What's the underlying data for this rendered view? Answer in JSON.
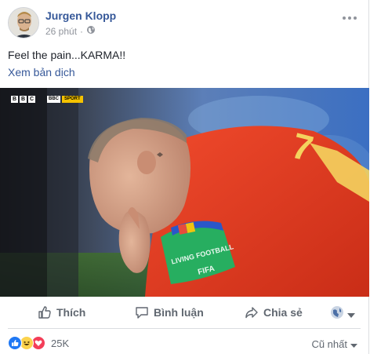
{
  "post": {
    "author": "Jurgen Klopp",
    "time": "26 phút",
    "dot": "·",
    "text": "Feel the pain...KARMA!!",
    "translate_link": "Xem bản dịch",
    "more_icon": "more-horizontal-icon",
    "privacy_icon": "globe-icon"
  },
  "photo": {
    "broadcaster": [
      "B",
      "B",
      "C"
    ],
    "broadcaster_sport_prefix": "BBC",
    "broadcaster_sport_suffix": "SPORT",
    "jersey_number": "7",
    "armband_text": "LIVING FOOTBALL",
    "armband_brand": "FIFA"
  },
  "actions": {
    "like": "Thích",
    "comment": "Bình luận",
    "share": "Chia sẻ"
  },
  "reactions": {
    "count": "25K",
    "sort_label": "Cũ nhất",
    "colors": {
      "like": "#2078f4",
      "haha": "#fcd34d",
      "love": "#f33e58"
    }
  },
  "colors": {
    "link": "#365899",
    "muted": "#90949c",
    "action": "#606770",
    "jersey": "#e8341c"
  }
}
